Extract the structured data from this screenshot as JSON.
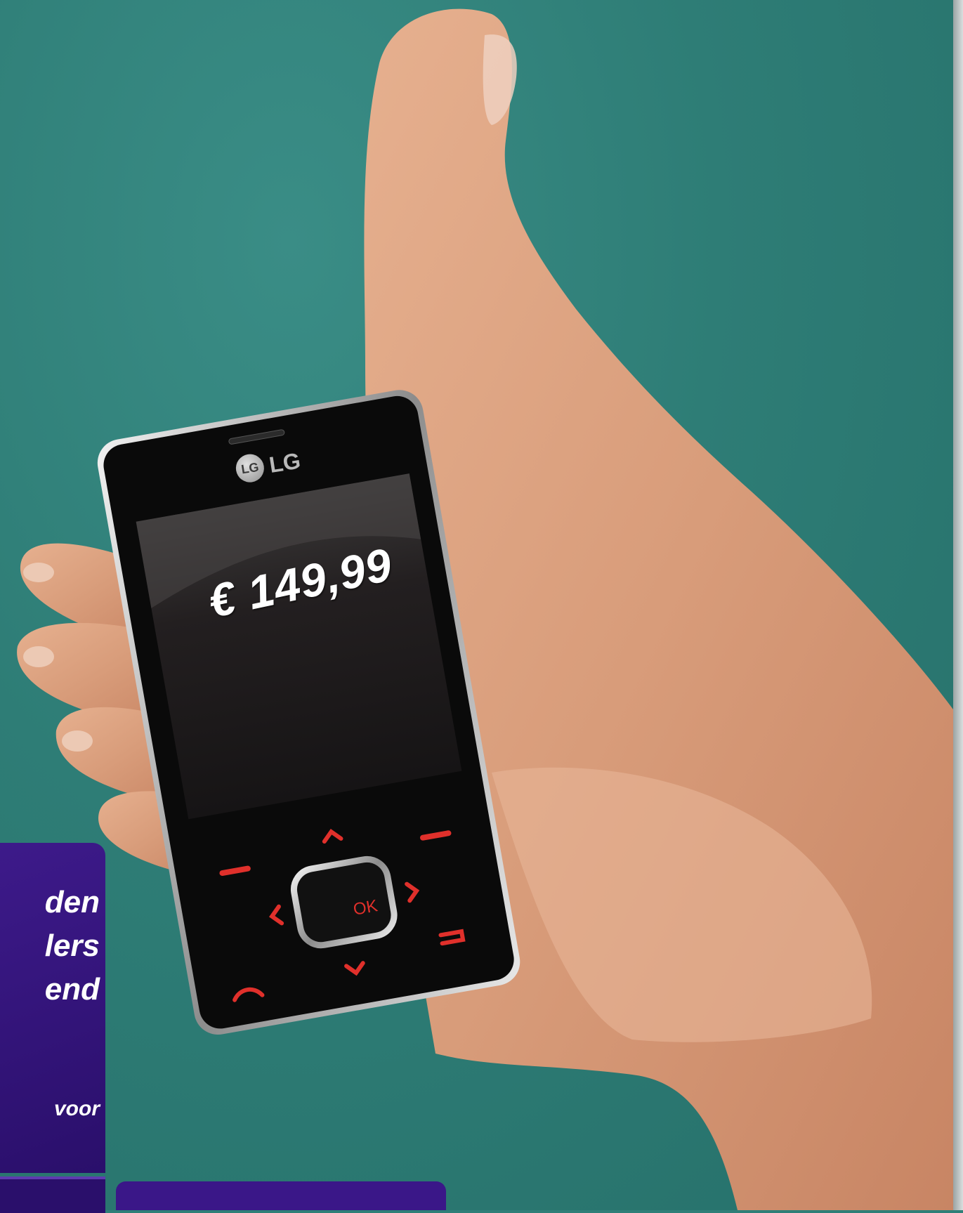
{
  "phone": {
    "brand_logo": "LG",
    "brand_text": "LG",
    "screen_price": "€ 149,99",
    "ok_key": "OK"
  },
  "promo": {
    "line1": "den",
    "line2": "lers",
    "line3": "end",
    "line4": "voor"
  },
  "colors": {
    "background": "#2f7f78",
    "promo_panel": "#2a0f6b",
    "phone_body": "#0a0a0a",
    "key_accent": "#e0302b"
  }
}
